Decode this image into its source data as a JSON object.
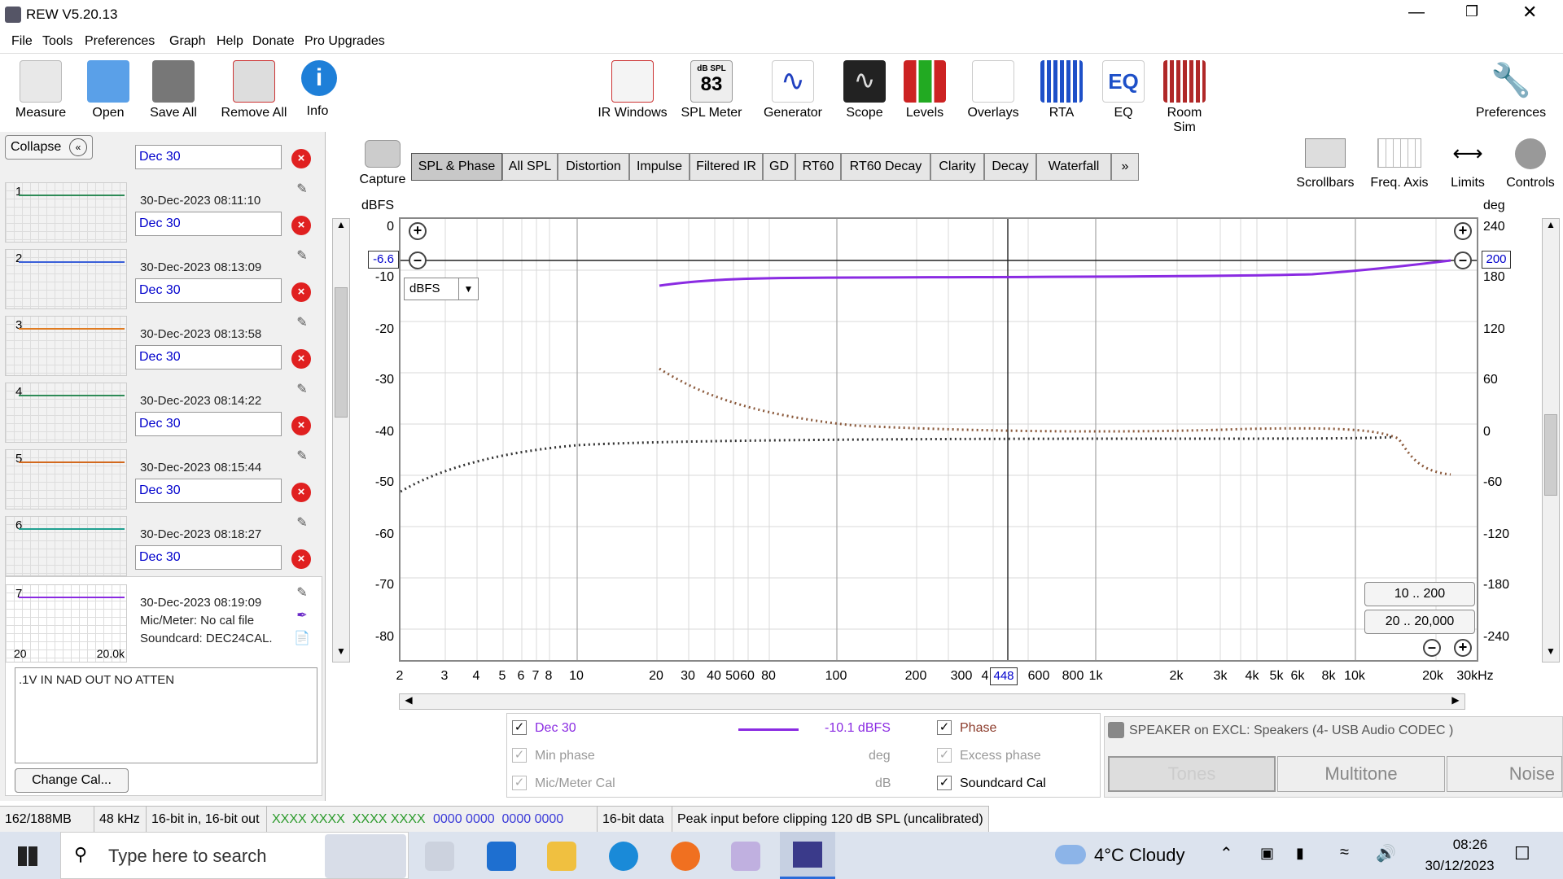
{
  "window": {
    "title": "REW V5.20.13"
  },
  "menu": [
    "File",
    "Tools",
    "Preferences",
    "Graph",
    "Help",
    "Donate",
    "Pro Upgrades"
  ],
  "toolbar": {
    "left": [
      "Measure",
      "Open",
      "Save All",
      "Remove All",
      "Info"
    ],
    "center": [
      "IR Windows",
      "SPL Meter",
      "Generator",
      "Scope",
      "Levels",
      "Overlays",
      "RTA",
      "EQ",
      "Room Sim"
    ],
    "spl_meter_value": "83",
    "spl_meter_unit": "dB SPL",
    "right": [
      "Preferences"
    ]
  },
  "leftpanel": {
    "collapse_label": "Collapse",
    "measurements": [
      {
        "num": "1",
        "name": "Dec 30",
        "date": "30-Dec-2023 08:11:10",
        "color": "#2e8b57"
      },
      {
        "num": "2",
        "name": "Dec 30",
        "date": "30-Dec-2023 08:13:09",
        "color": "#3a5fd8"
      },
      {
        "num": "3",
        "name": "Dec 30",
        "date": "30-Dec-2023 08:13:58",
        "color": "#e07b20"
      },
      {
        "num": "4",
        "name": "Dec 30",
        "date": "30-Dec-2023 08:14:22",
        "color": "#2e8b57"
      },
      {
        "num": "5",
        "name": "Dec 30",
        "date": "30-Dec-2023 08:15:44",
        "color": "#d2691e"
      },
      {
        "num": "6",
        "name": "Dec 30",
        "date": "30-Dec-2023 08:18:27",
        "color": "#20a090"
      },
      {
        "num": "7",
        "name": "Dec 30",
        "date": "30-Dec-2023 08:19:09",
        "color": "#8a2be2"
      }
    ],
    "selected": {
      "mic": "Mic/Meter: No cal file",
      "soundcard": "Soundcard: DEC24CAL.",
      "range_lo": "20",
      "range_hi": "20.0k"
    },
    "notes": ".1V IN NAD OUT NO ATTEN",
    "change_cal": "Change Cal..."
  },
  "graph": {
    "capture_label": "Capture",
    "tabs": [
      "SPL & Phase",
      "All SPL",
      "Distortion",
      "Impulse",
      "Filtered IR",
      "GD",
      "RT60",
      "RT60 Decay",
      "Clarity",
      "Decay",
      "Waterfall"
    ],
    "more_tab": "»",
    "active_tab": "SPL & Phase",
    "right_tools": [
      "Scrollbars",
      "Freq. Axis",
      "Limits",
      "Controls"
    ],
    "left_unit": "dBFS",
    "right_unit": "deg",
    "unit_select": "dBFS",
    "left_cursor_value": "-6.6",
    "right_cursor_value": "200",
    "cursor_freq": "448",
    "range_button_1": "10 .. 200",
    "range_button_2": "20 .. 20,000",
    "y_left_ticks": [
      "0",
      "-10",
      "-20",
      "-30",
      "-40",
      "-50",
      "-60",
      "-70",
      "-80"
    ],
    "y_right_ticks": [
      "240",
      "180",
      "120",
      "60",
      "0",
      "-60",
      "-120",
      "-180",
      "-240"
    ],
    "x_ticks": [
      "2",
      "3",
      "4",
      "5",
      "6",
      "7",
      "8",
      "10",
      "20",
      "30",
      "40",
      "50",
      "60",
      "80",
      "100",
      "200",
      "300",
      "4",
      "600",
      "800",
      "1k",
      "2k",
      "3k",
      "4k",
      "5k",
      "6k",
      "8k",
      "10k",
      "20k",
      "30kHz"
    ]
  },
  "legend": {
    "row1": {
      "name": "Dec 30",
      "value": "-10.1 dBFS",
      "right": "Phase"
    },
    "row2": {
      "name": "Min phase",
      "unit": "deg",
      "right": "Excess phase"
    },
    "row3": {
      "name": "Mic/Meter Cal",
      "unit": "dB",
      "right": "Soundcard Cal"
    },
    "trace_color": "#8a2be2"
  },
  "speaker": {
    "title": "SPEAKER on EXCL: Speakers (4- USB Audio CODEC )",
    "tabs": [
      "Tones",
      "Multitone",
      "Noise"
    ]
  },
  "status": [
    "162/188MB",
    "48 kHz",
    "16-bit in, 16-bit out",
    "XXXX XXXX",
    "XXXX XXXX",
    "0000 0000",
    "0000 0000",
    "16-bit data",
    "Peak input before clipping 120 dB SPL (uncalibrated)"
  ],
  "taskbar": {
    "search_placeholder": "Type here to search",
    "weather": "4°C  Cloudy",
    "time": "08:26",
    "date": "30/12/2023"
  }
}
